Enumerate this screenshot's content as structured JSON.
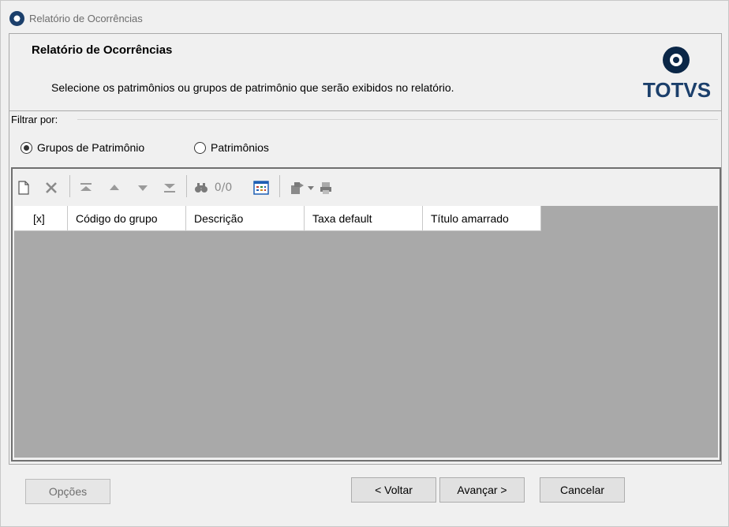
{
  "window": {
    "title": "Relatório de Ocorrências"
  },
  "header": {
    "title": "Relatório de Ocorrências",
    "description": "Selecione os patrimônios ou grupos de patrimônio que serão exibidos no relatório.",
    "logo_text": "TOTVS"
  },
  "filter": {
    "label": "Filtrar por:",
    "options": [
      {
        "label": "Grupos de Patrimônio",
        "checked": true
      },
      {
        "label": "Patrimônios",
        "checked": false
      }
    ]
  },
  "toolbar": {
    "record_counter": "0/0",
    "icons": [
      "new-document-icon",
      "delete-icon",
      "first-record-icon",
      "previous-record-icon",
      "next-record-icon",
      "last-record-icon",
      "find-icon",
      "grid-layout-icon",
      "process-icon",
      "dropdown-arrow-icon",
      "print-icon"
    ]
  },
  "grid": {
    "columns": [
      "[x]",
      "Código do grupo",
      "Descrição",
      "Taxa default",
      "Título amarrado"
    ],
    "rows": []
  },
  "footer": {
    "options_label": "Opções",
    "back_label": "< Voltar",
    "next_label": "Avançar >",
    "cancel_label": "Cancelar"
  },
  "colors": {
    "logo_blue": "#0b2747",
    "grid_background": "#a9a9a9",
    "window_background": "#f0f0f0",
    "calendar_icon_blue": "#1e5fb4"
  }
}
